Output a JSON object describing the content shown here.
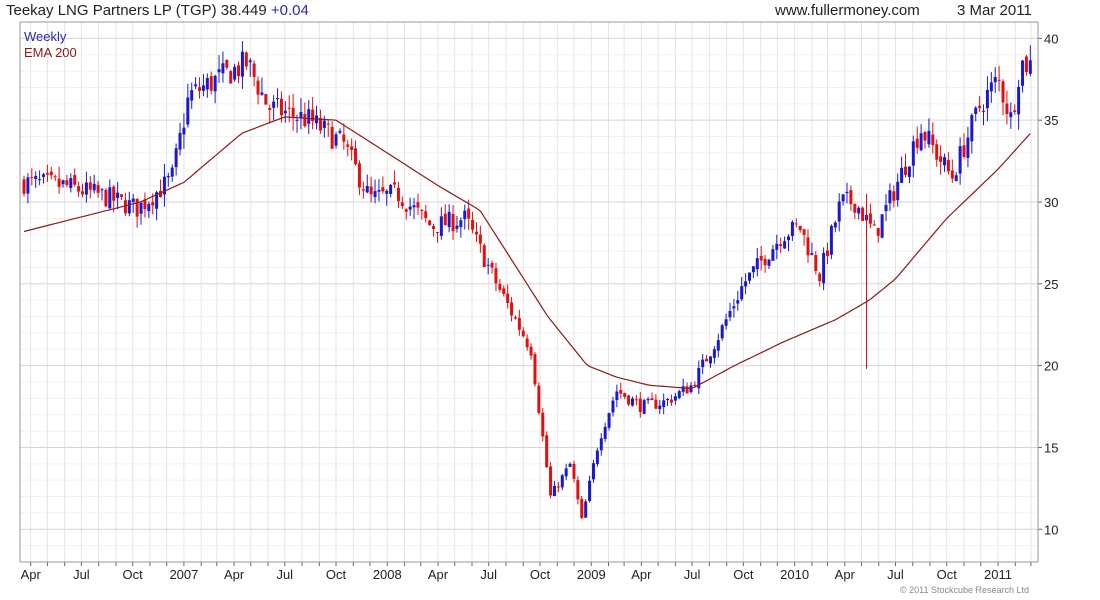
{
  "header": {
    "title": "Teekay LNG Partners LP (TGP) 38.449",
    "change": "+0.04",
    "site": "www.fullermoney.com",
    "date": "3 Mar 2011"
  },
  "legend": {
    "period": "Weekly",
    "ema": "EMA 200"
  },
  "copyright": "© 2011 Stockcube Research Ltd",
  "colors": {
    "up": "#1a1acc",
    "down": "#e01010",
    "ema": "#8b1a1a",
    "grid": "#e4e4e4",
    "frame": "#999999"
  },
  "chart_data": {
    "type": "candlestick",
    "title": "Teekay LNG Partners LP (TGP) 38.449 +0.04",
    "period": "Weekly",
    "x_range": [
      "2006-03-20",
      "2011-03-03"
    ],
    "ylim": [
      8,
      41
    ],
    "y_axis_side": "right",
    "y_ticks": [
      10,
      15,
      20,
      25,
      30,
      35,
      40
    ],
    "x_ticks": [
      {
        "label": "Apr",
        "date": "2006-04-01"
      },
      {
        "label": "Jul",
        "date": "2006-07-01"
      },
      {
        "label": "Oct",
        "date": "2006-10-01"
      },
      {
        "label": "2007",
        "date": "2007-01-01"
      },
      {
        "label": "Apr",
        "date": "2007-04-01"
      },
      {
        "label": "Jul",
        "date": "2007-07-01"
      },
      {
        "label": "Oct",
        "date": "2007-10-01"
      },
      {
        "label": "2008",
        "date": "2008-01-01"
      },
      {
        "label": "Apr",
        "date": "2008-04-01"
      },
      {
        "label": "Jul",
        "date": "2008-07-01"
      },
      {
        "label": "Oct",
        "date": "2008-10-01"
      },
      {
        "label": "2009",
        "date": "2009-01-01"
      },
      {
        "label": "Apr",
        "date": "2009-04-01"
      },
      {
        "label": "Jul",
        "date": "2009-07-01"
      },
      {
        "label": "Oct",
        "date": "2009-10-01"
      },
      {
        "label": "2010",
        "date": "2010-01-01"
      },
      {
        "label": "Apr",
        "date": "2010-04-01"
      },
      {
        "label": "Jul",
        "date": "2010-07-01"
      },
      {
        "label": "Oct",
        "date": "2010-10-01"
      },
      {
        "label": "2011",
        "date": "2011-01-01"
      }
    ],
    "grid": true,
    "legend": [
      "Weekly",
      "EMA 200"
    ],
    "close_anchors": [
      [
        "2006-03-20",
        31.2
      ],
      [
        "2006-06-01",
        31.0
      ],
      [
        "2006-08-15",
        30.3
      ],
      [
        "2006-10-10",
        29.6
      ],
      [
        "2006-12-10",
        31.4
      ],
      [
        "2007-01-10",
        36.5
      ],
      [
        "2007-03-01",
        37.5
      ],
      [
        "2007-04-25",
        38.5
      ],
      [
        "2007-06-01",
        35.8
      ],
      [
        "2007-08-15",
        35.0
      ],
      [
        "2007-10-15",
        33.5
      ],
      [
        "2007-12-01",
        30.2
      ],
      [
        "2008-01-20",
        30.5
      ],
      [
        "2008-03-20",
        28.5
      ],
      [
        "2008-05-20",
        29.0
      ],
      [
        "2008-07-15",
        25.0
      ],
      [
        "2008-09-15",
        21.0
      ],
      [
        "2008-10-20",
        12.0
      ],
      [
        "2008-11-25",
        14.0
      ],
      [
        "2008-12-15",
        10.5
      ],
      [
        "2009-01-15",
        15.5
      ],
      [
        "2009-02-15",
        18.5
      ],
      [
        "2009-04-01",
        17.5
      ],
      [
        "2009-05-15",
        17.8
      ],
      [
        "2009-07-01",
        18.8
      ],
      [
        "2009-08-20",
        22.0
      ],
      [
        "2009-10-01",
        25.0
      ],
      [
        "2009-12-10",
        28.0
      ],
      [
        "2010-01-10",
        28.5
      ],
      [
        "2010-02-15",
        25.5
      ],
      [
        "2010-03-25",
        30.0
      ],
      [
        "2010-04-20",
        30.0
      ],
      [
        "2010-05-25",
        28.0
      ],
      [
        "2010-07-15",
        32.0
      ],
      [
        "2010-08-15",
        34.5
      ],
      [
        "2010-10-10",
        31.5
      ],
      [
        "2010-12-01",
        36.0
      ],
      [
        "2011-01-01",
        37.5
      ],
      [
        "2011-01-25",
        35.0
      ],
      [
        "2011-02-10",
        38.5
      ],
      [
        "2011-03-03",
        38.4
      ]
    ],
    "ema_200": [
      [
        "2006-03-20",
        28.2
      ],
      [
        "2006-10-15",
        30.0
      ],
      [
        "2007-01-01",
        31.2
      ],
      [
        "2007-04-15",
        34.2
      ],
      [
        "2007-07-01",
        35.2
      ],
      [
        "2007-10-01",
        35.0
      ],
      [
        "2008-01-01",
        33.0
      ],
      [
        "2008-04-01",
        31.0
      ],
      [
        "2008-06-15",
        29.5
      ],
      [
        "2008-08-01",
        27.0
      ],
      [
        "2008-10-15",
        23.0
      ],
      [
        "2008-12-25",
        20.0
      ],
      [
        "2009-02-15",
        19.3
      ],
      [
        "2009-04-15",
        18.8
      ],
      [
        "2009-07-01",
        18.6
      ],
      [
        "2009-09-15",
        20.0
      ],
      [
        "2009-12-15",
        21.5
      ],
      [
        "2010-03-15",
        22.8
      ],
      [
        "2010-05-15",
        24.0
      ],
      [
        "2010-07-01",
        25.3
      ],
      [
        "2010-10-01",
        29.0
      ],
      [
        "2011-01-01",
        32.0
      ],
      [
        "2011-03-03",
        34.3
      ]
    ],
    "outlier_wicks": [
      {
        "date": "2010-05-10",
        "high": 30.5,
        "low": 19.8
      }
    ]
  }
}
